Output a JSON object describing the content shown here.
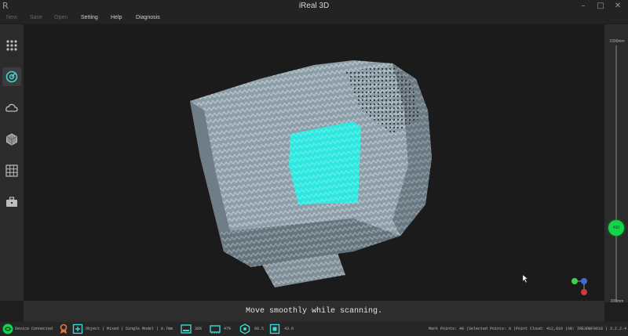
{
  "window": {
    "title": "iReal 3D",
    "logo": "R"
  },
  "menu": [
    {
      "label": "New",
      "enabled": false
    },
    {
      "label": "Save",
      "enabled": false
    },
    {
      "label": "Open",
      "enabled": false
    },
    {
      "label": "Setting",
      "enabled": true
    },
    {
      "label": "Help",
      "enabled": true
    },
    {
      "label": "Diagnosis",
      "enabled": true
    }
  ],
  "sidebar": [
    {
      "icon": "grid-dots-icon",
      "active": false
    },
    {
      "icon": "scan-icon",
      "active": true
    },
    {
      "icon": "cloud-icon",
      "active": false
    },
    {
      "icon": "mesh-cube-icon",
      "active": false
    },
    {
      "icon": "grid-table-icon",
      "active": false
    },
    {
      "icon": "toolbox-icon",
      "active": false
    }
  ],
  "distance_slider": {
    "max_label": "1000mm",
    "min_label": "200mm",
    "knob_label": "430",
    "min": 200,
    "max": 1000,
    "value": 430
  },
  "hint": "Move smoothly while scanning.",
  "status": {
    "device": "Device Connected",
    "mode": "Object | Mixed | Single Model | 0.7mm",
    "storage": "38%",
    "memory": "47%",
    "fps": "68.5",
    "frame_quality": "43.6",
    "info": "Mark Points: 40 |Selected Points: 0 |Point Cloud: 412,816 |SN: IRE3DBF0618 | 3.2.2.4"
  },
  "colors": {
    "accent_green": "#12d34a",
    "highlight_cyan": "#2ee8e0",
    "axis_x": "#d13a3a",
    "axis_y": "#3ecf4f",
    "axis_z": "#3b6fd8"
  }
}
